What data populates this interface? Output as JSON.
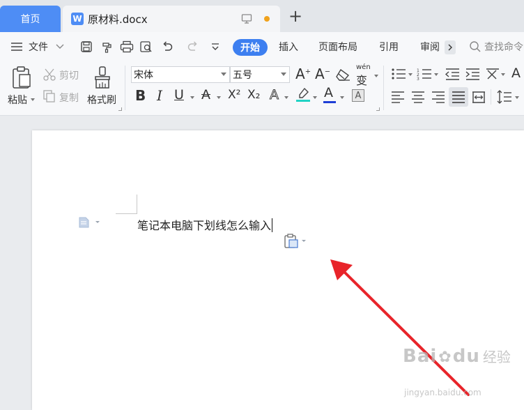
{
  "tabs": {
    "home_label": "首页",
    "doc_icon_letter": "W",
    "doc_title": "原材料.docx",
    "new_tab_symbol": "+"
  },
  "menubar": {
    "file_label": "文件",
    "tabs": [
      {
        "label": "开始",
        "active": true
      },
      {
        "label": "插入"
      },
      {
        "label": "页面布局"
      },
      {
        "label": "引用"
      },
      {
        "label": "审阅"
      }
    ],
    "search_placeholder": "查找命令",
    "icons": [
      "hamburger-icon",
      "save-icon",
      "format-painter-icon",
      "print-icon",
      "print-preview-icon",
      "undo-icon",
      "redo-icon",
      "customize-quick-access-icon",
      "search-icon"
    ]
  },
  "ribbon": {
    "paste_label": "粘贴",
    "cut_label": "剪切",
    "copy_label": "复制",
    "format_painter_label": "格式刷",
    "font_name": "宋体",
    "font_size": "五号",
    "text_effect_glyph": "A",
    "bold": "B",
    "italic": "I",
    "underline": "U",
    "strike": "A",
    "superscript": "X²",
    "subscript": "X₂",
    "font_color_letter": "A",
    "char_shade_letter": "A",
    "grow_font": "A",
    "shrink_font": "A",
    "phonetic": "wén",
    "phonetic_char": "变",
    "highlight_color": "#22d3c5",
    "font_color": "#1f3fd6"
  },
  "document": {
    "text": "笔记本电脑下划线怎么输入"
  },
  "annotation": {
    "arrow_color": "#e8242a"
  },
  "watermark": {
    "brand": "Bai",
    "brand2": "du",
    "cn": "经验",
    "url": "jingyan.baidu.com"
  }
}
